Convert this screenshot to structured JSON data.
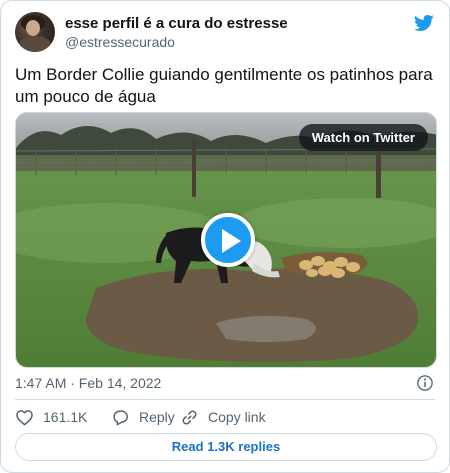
{
  "author": {
    "display_name": "esse perfil é a cura do estresse",
    "handle": "@estressecurado"
  },
  "tweet": {
    "text": "Um Border Collie guiando gentilmente os patinhos para um pouco de água",
    "timestamp": "1:47 AM · Feb 14, 2022"
  },
  "media": {
    "watch_label": "Watch on Twitter"
  },
  "actions": {
    "likes": "161.1K",
    "reply_label": "Reply",
    "copy_label": "Copy link"
  },
  "replies_button": "Read 1.3K replies",
  "colors": {
    "twitter_blue": "#1d9bf0",
    "text_primary": "#0f1419",
    "text_secondary": "#536471",
    "border": "#cfd9de"
  },
  "icons": [
    "twitter-bird-icon",
    "play-icon",
    "info-icon",
    "heart-icon",
    "reply-icon",
    "link-icon"
  ]
}
